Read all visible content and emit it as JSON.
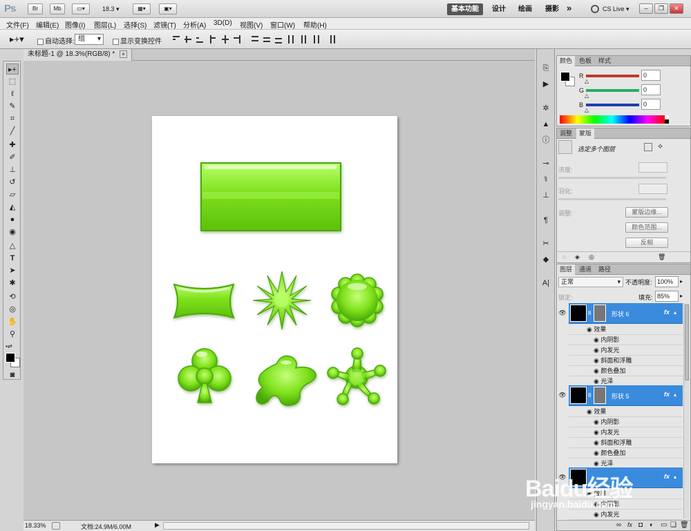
{
  "app": {
    "logo": "Ps",
    "zoom_select": "18.3",
    "workspace_tabs": [
      "基本功能",
      "设计",
      "绘画",
      "摄影"
    ],
    "more": "»",
    "cslive": "CS Live",
    "bridge_btn": "Br",
    "minibridge_btn": "Mb"
  },
  "menu": [
    "文件(F)",
    "编辑(E)",
    "图像(I)",
    "图层(L)",
    "选择(S)",
    "滤镜(T)",
    "分析(A)",
    "3D(D)",
    "视图(V)",
    "窗口(W)",
    "帮助(H)"
  ],
  "options": {
    "auto_select_label": "自动选择:",
    "auto_select_value": "组",
    "show_transform": "显示变换控件"
  },
  "document": {
    "tab_title": "未标题-1 @ 18.3%(RGB/8) *",
    "close": "×"
  },
  "status": {
    "zoom": "18.33%",
    "doc_info": "文档:24.9M/6.00M"
  },
  "color_panel": {
    "tabs": [
      "颜色",
      "色板",
      "样式"
    ],
    "channels": [
      {
        "name": "R",
        "value": "0",
        "color": "#c0392b"
      },
      {
        "name": "G",
        "value": "0",
        "color": "#27ae60"
      },
      {
        "name": "B",
        "value": "0",
        "color": "#1d3fb0"
      }
    ]
  },
  "adjust_panel": {
    "tabs": [
      "调整",
      "蒙版"
    ],
    "title": "选定多个图层",
    "density": "浓度:",
    "feather": "羽化:",
    "refine": "调整:",
    "btn_edge": "蒙版边缘...",
    "btn_color": "颜色范围...",
    "btn_invert": "反相"
  },
  "layers_panel": {
    "tabs": [
      "图层",
      "通道",
      "路径"
    ],
    "blend": "正常",
    "opacity_label": "不透明度:",
    "opacity": "100%",
    "lock_label": "锁定:",
    "fill_label": "填充:",
    "fill": "85%",
    "layers": [
      {
        "name": "形状 6",
        "fx": "fx",
        "effects_label": "效果",
        "effects": [
          "内阴影",
          "内发光",
          "斜面和浮雕",
          "颜色叠加",
          "光泽"
        ]
      },
      {
        "name": "形状 5",
        "fx": "fx",
        "effects_label": "效果",
        "effects": [
          "内阴影",
          "内发光",
          "斜面和浮雕",
          "颜色叠加",
          "光泽"
        ]
      },
      {
        "name": "",
        "fx": "fx",
        "effects_label": "效果",
        "effects": [
          "内阴影",
          "内发光"
        ]
      }
    ]
  },
  "watermark": {
    "brand": "Baidu经验",
    "url": "jingyan.baidu.com"
  },
  "colors": {
    "shape_green": "#7ee01a",
    "shape_dark": "#3f9a0a",
    "selection_blue": "#3a8bde"
  }
}
